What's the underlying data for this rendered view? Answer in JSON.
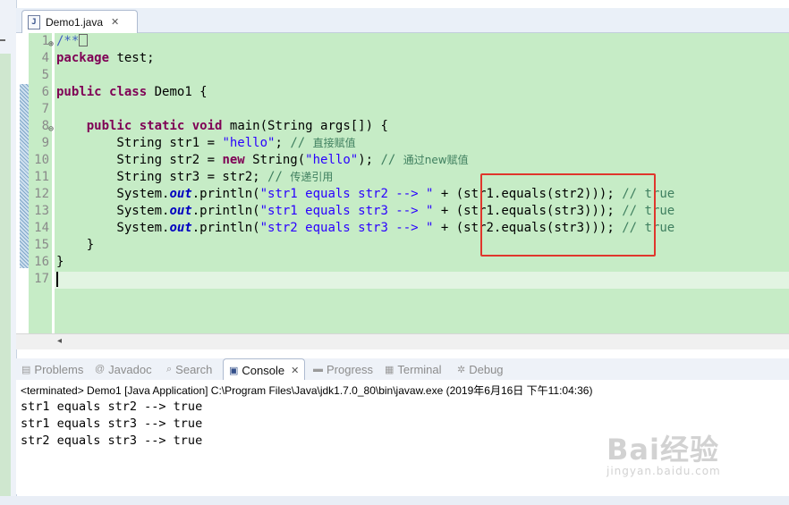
{
  "editor": {
    "tab": {
      "icon": "java-file-icon",
      "label": "Demo1.java",
      "close": "✕"
    },
    "lines": [
      {
        "n": "1",
        "fold": "⊕",
        "segs": [
          {
            "t": "/**",
            "c": "jd"
          }
        ]
      },
      {
        "n": "4",
        "segs": [
          {
            "t": "package",
            "c": "kw"
          },
          {
            "t": " test;"
          }
        ]
      },
      {
        "n": "5",
        "segs": []
      },
      {
        "n": "6",
        "segs": [
          {
            "t": "public",
            "c": "kw"
          },
          {
            "t": " "
          },
          {
            "t": "class",
            "c": "kw"
          },
          {
            "t": " Demo1 {"
          }
        ]
      },
      {
        "n": "7",
        "segs": []
      },
      {
        "n": "8",
        "fold": "⊖",
        "segs": [
          {
            "t": "    "
          },
          {
            "t": "public",
            "c": "kw"
          },
          {
            "t": " "
          },
          {
            "t": "static",
            "c": "kw"
          },
          {
            "t": " "
          },
          {
            "t": "void",
            "c": "kw"
          },
          {
            "t": " main(String args[]) {"
          }
        ]
      },
      {
        "n": "9",
        "segs": [
          {
            "t": "        String str1 = "
          },
          {
            "t": "\"hello\"",
            "c": "str"
          },
          {
            "t": "; "
          },
          {
            "t": "// ",
            "c": "cm"
          },
          {
            "t": "直接赋值",
            "c": "cmz"
          }
        ]
      },
      {
        "n": "10",
        "segs": [
          {
            "t": "        String str2 = "
          },
          {
            "t": "new",
            "c": "kw"
          },
          {
            "t": " String("
          },
          {
            "t": "\"hello\"",
            "c": "str"
          },
          {
            "t": "); "
          },
          {
            "t": "// ",
            "c": "cm"
          },
          {
            "t": "通过new赋值",
            "c": "cmz"
          }
        ]
      },
      {
        "n": "11",
        "segs": [
          {
            "t": "        String str3 = str2; "
          },
          {
            "t": "// ",
            "c": "cm"
          },
          {
            "t": "传递引用",
            "c": "cmz"
          }
        ]
      },
      {
        "n": "12",
        "segs": [
          {
            "t": "        System."
          },
          {
            "t": "out",
            "c": "st"
          },
          {
            "t": ".println("
          },
          {
            "t": "\"str1 equals str2 --> \"",
            "c": "str"
          },
          {
            "t": " + (str1.equals(str2))); "
          },
          {
            "t": "// true",
            "c": "cm"
          }
        ]
      },
      {
        "n": "13",
        "segs": [
          {
            "t": "        System."
          },
          {
            "t": "out",
            "c": "st"
          },
          {
            "t": ".println("
          },
          {
            "t": "\"str1 equals str3 --> \"",
            "c": "str"
          },
          {
            "t": " + (str1.equals(str3))); "
          },
          {
            "t": "// true",
            "c": "cm"
          }
        ]
      },
      {
        "n": "14",
        "segs": [
          {
            "t": "        System."
          },
          {
            "t": "out",
            "c": "st"
          },
          {
            "t": ".println("
          },
          {
            "t": "\"str2 equals str3 --> \"",
            "c": "str"
          },
          {
            "t": " + (str2.equals(str3))); "
          },
          {
            "t": "// true",
            "c": "cm"
          }
        ]
      },
      {
        "n": "15",
        "segs": [
          {
            "t": "    }"
          }
        ]
      },
      {
        "n": "16",
        "segs": [
          {
            "t": "}"
          }
        ]
      },
      {
        "n": "17",
        "segs": []
      }
    ]
  },
  "views": {
    "tabs": [
      {
        "label": "Problems",
        "icon": "problems-icon",
        "glyph": "▤",
        "active": false
      },
      {
        "label": "Javadoc",
        "icon": "javadoc-icon",
        "glyph": "@",
        "active": false
      },
      {
        "label": "Search",
        "icon": "search-icon",
        "glyph": "⌕",
        "active": false
      },
      {
        "label": "Console",
        "icon": "console-icon",
        "glyph": "▣",
        "active": true,
        "close": "✕"
      },
      {
        "label": "Progress",
        "icon": "progress-icon",
        "glyph": "▬",
        "active": false
      },
      {
        "label": "Terminal",
        "icon": "terminal-icon",
        "glyph": "▦",
        "active": false
      },
      {
        "label": "Debug",
        "icon": "debug-icon",
        "glyph": "✲",
        "active": false
      }
    ]
  },
  "console": {
    "status": "<terminated> Demo1 [Java Application] C:\\Program Files\\Java\\jdk1.7.0_80\\bin\\javaw.exe (2019年6月16日 下午11:04:36)",
    "output": [
      "str1 equals str2 --> true",
      "str1 equals str3 --> true",
      "str2 equals str3 --> true"
    ]
  },
  "watermark": {
    "text": "Bai经验",
    "url": "jingyan.baidu.com"
  },
  "colors": {
    "editor_bg": "#c6ecc6",
    "keyword": "#7f0055",
    "string": "#2a00ff",
    "comment": "#3f7f5f",
    "highlight_box": "#e0362c"
  }
}
